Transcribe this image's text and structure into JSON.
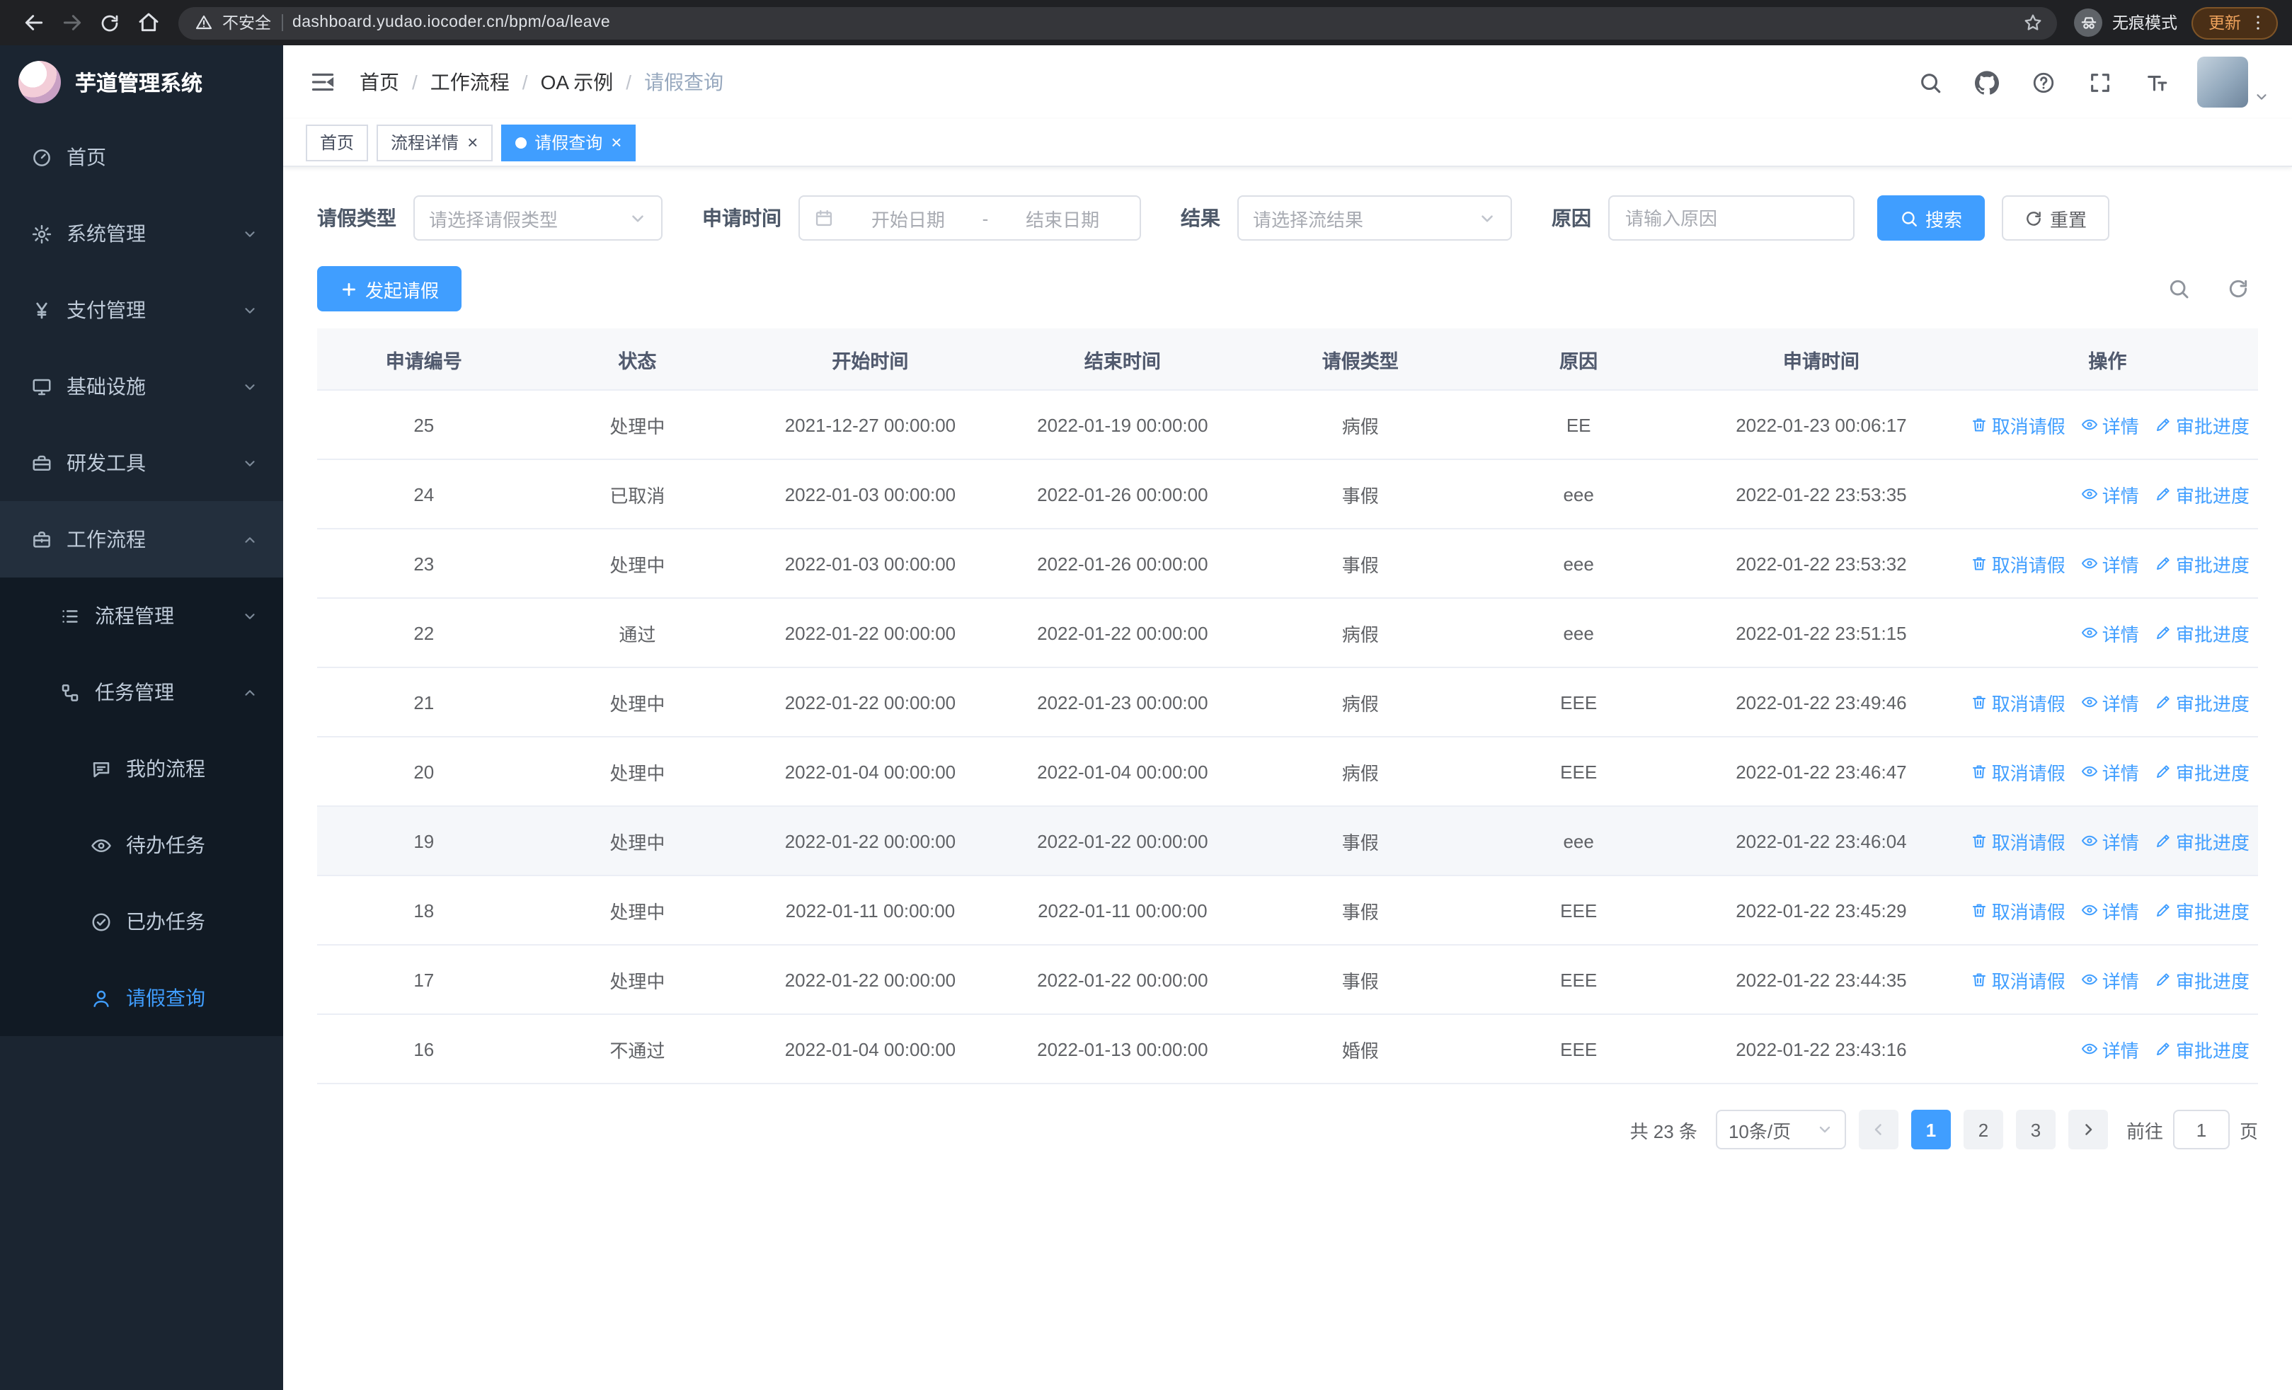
{
  "colors": {
    "accent": "#409eff",
    "chrome-bg": "#202124",
    "sidebar-bg": "#1b2531",
    "submenu-bg": "#111a24",
    "parent-open-bg": "#232f3d"
  },
  "browser": {
    "security_label": "不安全",
    "url": "dashboard.yudao.iocoder.cn/bpm/oa/leave",
    "incognito_label": "无痕模式",
    "update_label": "更新"
  },
  "sidebar": {
    "app_title": "芋道管理系统",
    "items": [
      {
        "label": "首页",
        "icon": "dashboard-icon"
      },
      {
        "label": "系统管理",
        "icon": "gear-icon"
      },
      {
        "label": "支付管理",
        "icon": "yen-icon"
      },
      {
        "label": "基础设施",
        "icon": "monitor-icon"
      },
      {
        "label": "研发工具",
        "icon": "toolbox-icon"
      },
      {
        "label": "工作流程",
        "icon": "briefcase-icon"
      },
      {
        "label": "流程管理",
        "icon": "list-icon"
      },
      {
        "label": "任务管理",
        "icon": "flow-icon"
      },
      {
        "label": "我的流程",
        "icon": "chat-icon"
      },
      {
        "label": "待办任务",
        "icon": "eye-icon"
      },
      {
        "label": "已办任务",
        "icon": "check-circle-icon"
      },
      {
        "label": "请假查询",
        "icon": "user-icon"
      }
    ]
  },
  "breadcrumb": {
    "sep": "/",
    "items": [
      "首页",
      "工作流程",
      "OA 示例",
      "请假查询"
    ]
  },
  "tabs": {
    "close_glyph": "×",
    "items": [
      {
        "label": "首页"
      },
      {
        "label": "流程详情"
      },
      {
        "label": "请假查询"
      }
    ]
  },
  "filters": {
    "leave_type_label": "请假类型",
    "leave_type_placeholder": "请选择请假类型",
    "apply_time_label": "申请时间",
    "start_placeholder": "开始日期",
    "range_separator": "-",
    "end_placeholder": "结束日期",
    "result_label": "结果",
    "result_placeholder": "请选择流结果",
    "reason_label": "原因",
    "reason_placeholder": "请输入原因",
    "search_label": "搜索",
    "reset_label": "重置"
  },
  "toolbar": {
    "create_label": "发起请假"
  },
  "table": {
    "columns": [
      "申请编号",
      "状态",
      "开始时间",
      "结束时间",
      "请假类型",
      "原因",
      "申请时间",
      "操作"
    ],
    "action_labels": {
      "cancel": "取消请假",
      "detail": "详情",
      "progress": "审批进度"
    },
    "rows": [
      {
        "id": "25",
        "status": "处理中",
        "start": "2021-12-27 00:00:00",
        "end": "2022-01-19 00:00:00",
        "type": "病假",
        "reason": "EE",
        "applied": "2022-01-23 00:06:17"
      },
      {
        "id": "24",
        "status": "已取消",
        "start": "2022-01-03 00:00:00",
        "end": "2022-01-26 00:00:00",
        "type": "事假",
        "reason": "eee",
        "applied": "2022-01-22 23:53:35"
      },
      {
        "id": "23",
        "status": "处理中",
        "start": "2022-01-03 00:00:00",
        "end": "2022-01-26 00:00:00",
        "type": "事假",
        "reason": "eee",
        "applied": "2022-01-22 23:53:32"
      },
      {
        "id": "22",
        "status": "通过",
        "start": "2022-01-22 00:00:00",
        "end": "2022-01-22 00:00:00",
        "type": "病假",
        "reason": "eee",
        "applied": "2022-01-22 23:51:15"
      },
      {
        "id": "21",
        "status": "处理中",
        "start": "2022-01-22 00:00:00",
        "end": "2022-01-23 00:00:00",
        "type": "病假",
        "reason": "EEE",
        "applied": "2022-01-22 23:49:46"
      },
      {
        "id": "20",
        "status": "处理中",
        "start": "2022-01-04 00:00:00",
        "end": "2022-01-04 00:00:00",
        "type": "病假",
        "reason": "EEE",
        "applied": "2022-01-22 23:46:47"
      },
      {
        "id": "19",
        "status": "处理中",
        "start": "2022-01-22 00:00:00",
        "end": "2022-01-22 00:00:00",
        "type": "事假",
        "reason": "eee",
        "applied": "2022-01-22 23:46:04"
      },
      {
        "id": "18",
        "status": "处理中",
        "start": "2022-01-11 00:00:00",
        "end": "2022-01-11 00:00:00",
        "type": "事假",
        "reason": "EEE",
        "applied": "2022-01-22 23:45:29"
      },
      {
        "id": "17",
        "status": "处理中",
        "start": "2022-01-22 00:00:00",
        "end": "2022-01-22 00:00:00",
        "type": "事假",
        "reason": "EEE",
        "applied": "2022-01-22 23:44:35"
      },
      {
        "id": "16",
        "status": "不通过",
        "start": "2022-01-04 00:00:00",
        "end": "2022-01-13 00:00:00",
        "type": "婚假",
        "reason": "EEE",
        "applied": "2022-01-22 23:43:16"
      }
    ]
  },
  "pagination": {
    "total_text": "共 23 条",
    "page_size": "10条/页",
    "pages": [
      "1",
      "2",
      "3"
    ],
    "current_page": "1",
    "goto_label": "前往",
    "goto_value": "1",
    "page_unit": "页"
  }
}
